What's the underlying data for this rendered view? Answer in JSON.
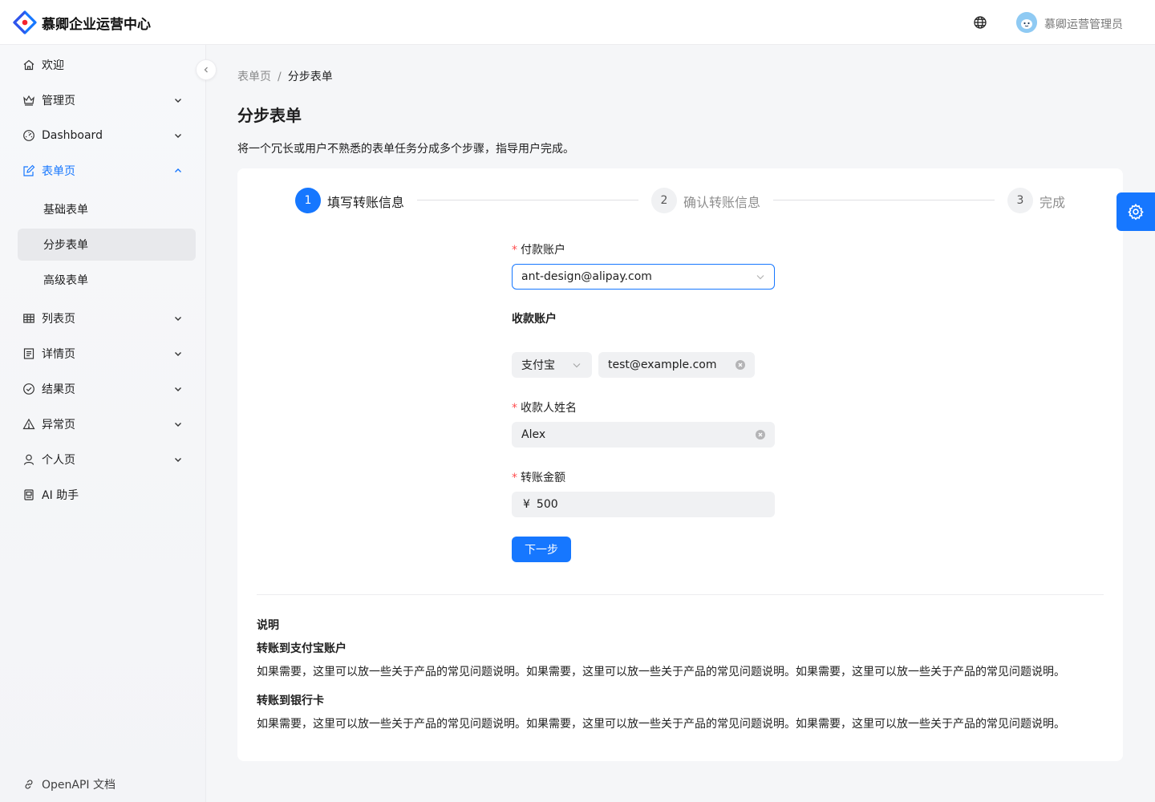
{
  "header": {
    "app_title": "慕卿企业运营中心",
    "user_name": "慕卿运营管理员"
  },
  "sidebar": {
    "items": [
      {
        "label": "欢迎",
        "icon": "home-icon"
      },
      {
        "label": "管理页",
        "icon": "crown-icon"
      },
      {
        "label": "Dashboard",
        "icon": "dashboard-icon"
      },
      {
        "label": "表单页",
        "icon": "form-icon"
      },
      {
        "label": "列表页",
        "icon": "table-icon"
      },
      {
        "label": "详情页",
        "icon": "profile-icon"
      },
      {
        "label": "结果页",
        "icon": "check-circle-icon"
      },
      {
        "label": "异常页",
        "icon": "warning-icon"
      },
      {
        "label": "个人页",
        "icon": "user-icon"
      },
      {
        "label": "AI 助手",
        "icon": "robot-icon"
      }
    ],
    "sub_items": [
      {
        "label": "基础表单"
      },
      {
        "label": "分步表单"
      },
      {
        "label": "高级表单"
      }
    ],
    "footer_link": "OpenAPI 文档"
  },
  "breadcrumb": {
    "parent": "表单页",
    "separator": "/",
    "current": "分步表单"
  },
  "page": {
    "title": "分步表单",
    "description": "将一个冗长或用户不熟悉的表单任务分成多个步骤，指导用户完成。"
  },
  "steps": [
    {
      "number": "1",
      "title": "填写转账信息",
      "status": "active"
    },
    {
      "number": "2",
      "title": "确认转账信息",
      "status": "wait"
    },
    {
      "number": "3",
      "title": "完成",
      "status": "wait"
    }
  ],
  "form": {
    "required_mark": "*",
    "pay_account_label": "付款账户",
    "pay_account_value": "ant-design@alipay.com",
    "receive_account_label": "收款账户",
    "receive_type_value": "支付宝",
    "receive_account_value": "test@example.com",
    "receiver_name_label": "收款人姓名",
    "receiver_name_value": "Alex",
    "amount_label": "转账金额",
    "amount_prefix": "¥",
    "amount_value": "500",
    "next_button": "下一步"
  },
  "notes": {
    "title": "说明",
    "sections": [
      {
        "heading": "转账到支付宝账户",
        "text": "如果需要，这里可以放一些关于产品的常见问题说明。如果需要，这里可以放一些关于产品的常见问题说明。如果需要，这里可以放一些关于产品的常见问题说明。"
      },
      {
        "heading": "转账到银行卡",
        "text": "如果需要，这里可以放一些关于产品的常见问题说明。如果需要，这里可以放一些关于产品的常见问题说明。如果需要，这里可以放一些关于产品的常见问题说明。"
      }
    ]
  },
  "colors": {
    "primary": "#1677ff",
    "required": "#ff4d4f"
  }
}
